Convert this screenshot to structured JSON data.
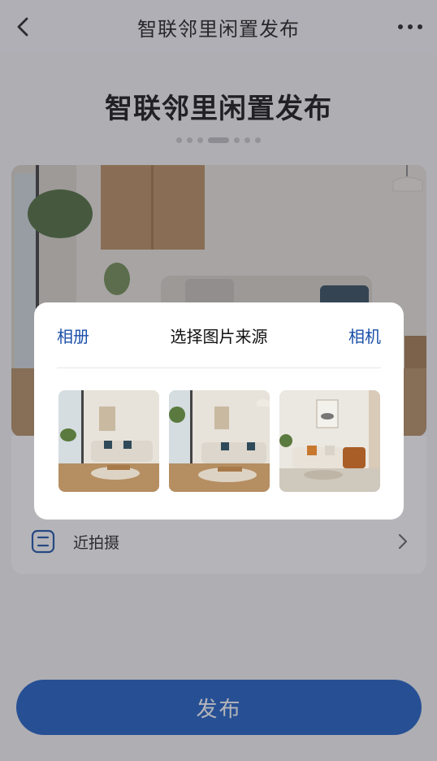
{
  "nav": {
    "title": "智联邻里闲置发布",
    "back_icon": "chevron-left-icon",
    "more_icon": "more-horizontal-icon"
  },
  "page": {
    "title": "智联邻里闲置发布"
  },
  "carousel": {
    "count": 7,
    "active_index": 3
  },
  "list": {
    "items": [
      {
        "label": "近拍摄",
        "icon": "camera-icon"
      }
    ]
  },
  "publish": {
    "label": "发布",
    "color": "#1a5cc4"
  },
  "modal": {
    "left_link": "相册",
    "title": "选择图片来源",
    "right_link": "相机",
    "link_color": "#1a4fa8"
  }
}
